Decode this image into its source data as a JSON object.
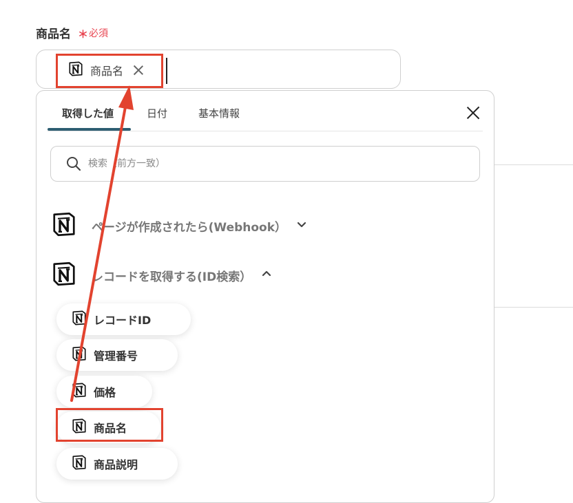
{
  "field": {
    "label": "商品名",
    "required_mark": "＊",
    "required_text": "必須",
    "chip_label": "商品名"
  },
  "panel": {
    "tabs": [
      {
        "label": "取得した値",
        "active": true
      },
      {
        "label": "日付",
        "active": false
      },
      {
        "label": "基本情報",
        "active": false
      }
    ],
    "search_placeholder": "検索（前方一致）",
    "groups": [
      {
        "label": "ページが作成されたら(Webhook）",
        "expanded": false,
        "icon": "notion-icon"
      },
      {
        "label": "レコードを取得する(ID検索）",
        "expanded": true,
        "icon": "notion-icon"
      }
    ],
    "items": [
      {
        "label": "レコードID"
      },
      {
        "label": "管理番号"
      },
      {
        "label": "価格"
      },
      {
        "label": "商品名"
      },
      {
        "label": "商品説明"
      }
    ]
  },
  "colors": {
    "accent": "#2e5e72",
    "required": "#e8434f",
    "highlight": "#e2432f"
  },
  "icons": {
    "chip_remove": "close-icon",
    "panel_close": "close-icon",
    "search": "search-icon",
    "collapsed": "chevron-down-icon",
    "expanded": "chevron-up-icon"
  }
}
